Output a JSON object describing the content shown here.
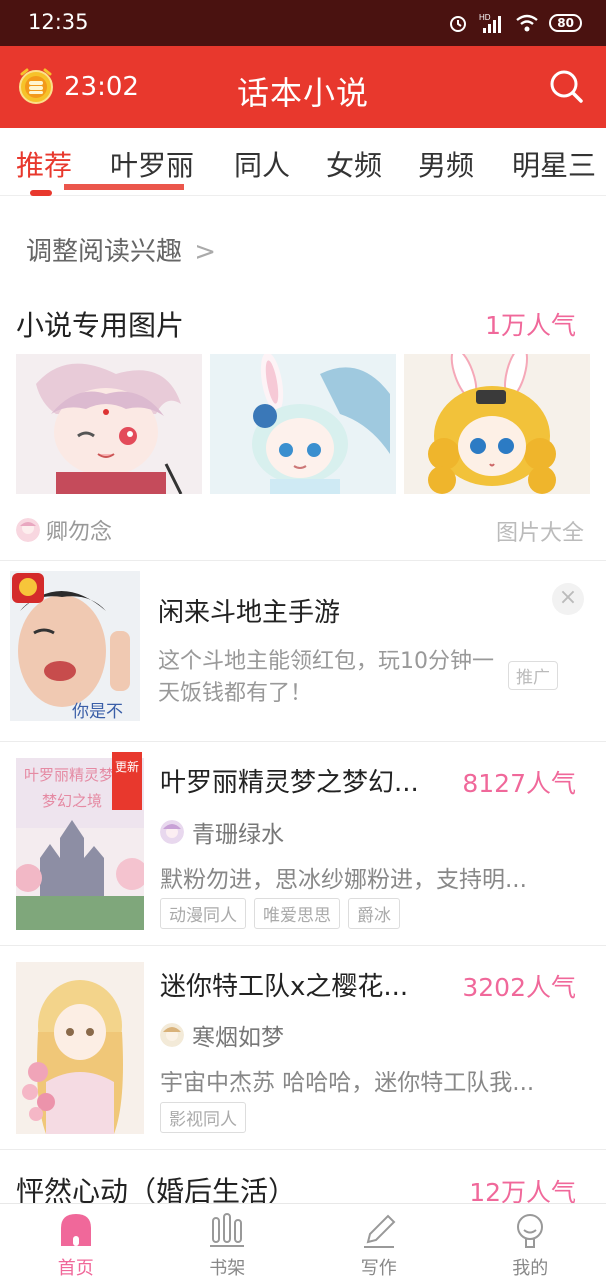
{
  "status_bar": {
    "time": "12:35",
    "battery": "80",
    "hd": "HD"
  },
  "app_bar": {
    "timer": "23:02",
    "title": "话本小说"
  },
  "tabs": [
    {
      "label": "推荐",
      "active": true
    },
    {
      "label": "叶罗丽",
      "active": false
    },
    {
      "label": "同人",
      "active": false
    },
    {
      "label": "女频",
      "active": false
    },
    {
      "label": "男频",
      "active": false
    },
    {
      "label": "明星三",
      "active": false
    }
  ],
  "interest": {
    "label": "调整阅读兴趣",
    "chevron": ">"
  },
  "image_section": {
    "title": "小说专用图片",
    "popularity": "1万人气",
    "author": "卿勿念",
    "more": "图片大全"
  },
  "ad": {
    "title": "闲来斗地主手游",
    "description": "这个斗地主能领红包，玩10分钟一天饭钱都有了！",
    "badge": "推广",
    "close": "×",
    "thumb_caption": "你是不"
  },
  "books": [
    {
      "title": "叶罗丽精灵梦之梦幻...",
      "popularity": "8127人气",
      "author": "青珊绿水",
      "description": "默粉勿进，思冰纱娜粉进，支持明...",
      "tags": [
        "动漫同人",
        "唯爱思思",
        "爵冰"
      ],
      "ribbon": "更新"
    },
    {
      "title": "迷你特工队x之樱花...",
      "popularity": "3202人气",
      "author": "寒烟如梦",
      "description": "宇宙中杰苏 哈哈哈，迷你特工队我...",
      "tags": [
        "影视同人"
      ],
      "ribbon": ""
    }
  ],
  "next_book": {
    "title": "怦然心动（婚后生活）",
    "popularity": "12万人气"
  },
  "bottom_nav": [
    {
      "label": "首页",
      "active": true,
      "icon": "home-icon"
    },
    {
      "label": "书架",
      "active": false,
      "icon": "bookshelf-icon"
    },
    {
      "label": "写作",
      "active": false,
      "icon": "pencil-icon"
    },
    {
      "label": "我的",
      "active": false,
      "icon": "profile-icon"
    }
  ],
  "colors": {
    "app_bar": "#e8382d",
    "accent_pink": "#f0689a",
    "status_bar": "#4a1210"
  }
}
